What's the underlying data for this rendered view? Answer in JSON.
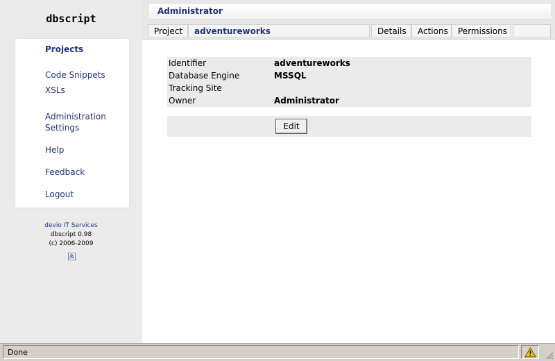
{
  "brand": "dbscript",
  "nav": {
    "items": [
      {
        "label": "Projects"
      },
      {
        "label": "Code Snippets"
      },
      {
        "label": "XSLs"
      },
      {
        "label": "Administration"
      },
      {
        "label": "Settings"
      },
      {
        "label": "Help"
      },
      {
        "label": "Feedback"
      },
      {
        "label": "Logout"
      }
    ]
  },
  "credits": {
    "company": "devio IT Services",
    "version": "dbscript 0.98",
    "copyright": "(c) 2006-2009"
  },
  "header": {
    "title": "Administrator"
  },
  "tabs": {
    "project_label": "Project",
    "project_name": "adventureworks",
    "details": "Details",
    "actions": "Actions",
    "permissions": "Permissions"
  },
  "properties": [
    {
      "label": "Identifier",
      "value": "adventureworks"
    },
    {
      "label": "Database Engine",
      "value": "MSSQL"
    },
    {
      "label": "Tracking Site",
      "value": ""
    },
    {
      "label": "Owner",
      "value": "Administrator"
    }
  ],
  "actions": {
    "edit_label": "Edit"
  },
  "status": {
    "text": "Done"
  },
  "colors": {
    "link": "#22327a",
    "panel": "#ebebeb",
    "page_bg": "#e8e8e8"
  }
}
